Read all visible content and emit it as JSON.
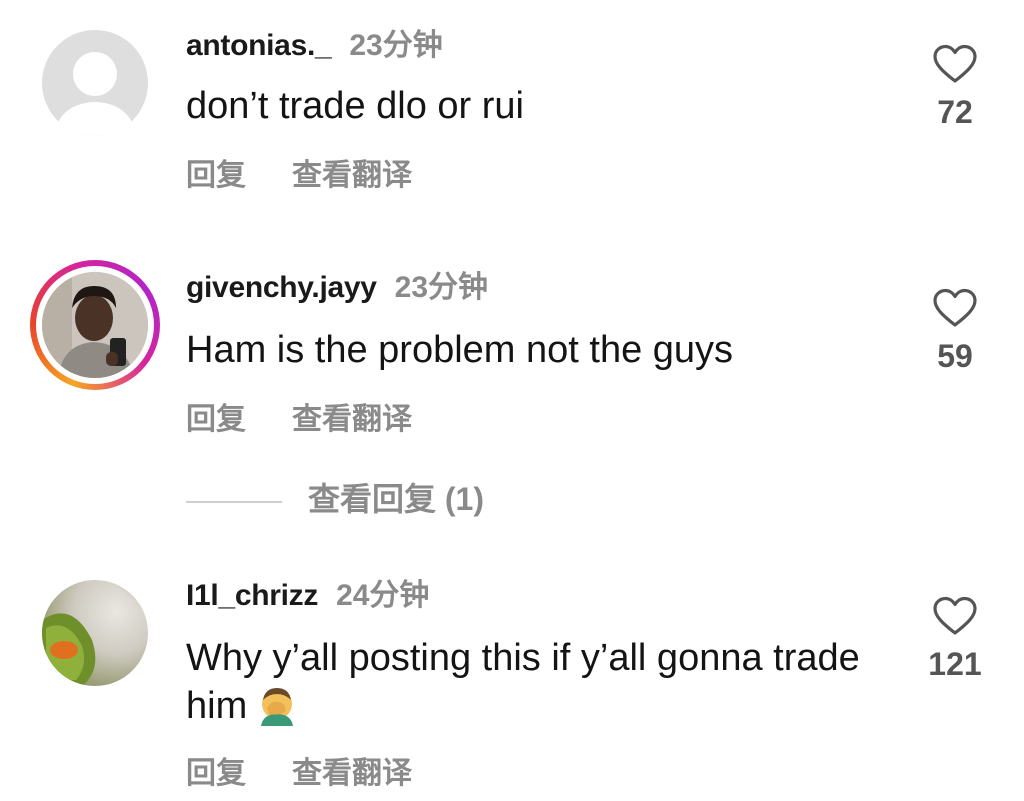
{
  "comments": [
    {
      "username": "antonias._",
      "time": "23分钟",
      "text": "don’t trade dlo or rui",
      "reply_label": "回复",
      "translate_label": "查看翻译",
      "likes": "72"
    },
    {
      "username": "givenchy.jayy",
      "time": "23分钟",
      "text": "Ham is the problem not the guys",
      "reply_label": "回复",
      "translate_label": "查看翻译",
      "likes": "59",
      "view_replies_label": "查看回复 (1)"
    },
    {
      "username": "I1l_chrizz",
      "time": "24分钟",
      "text": "Why y’all posting this if y’all gonna trade him",
      "reply_label": "回复",
      "translate_label": "查看翻译",
      "likes": "121"
    }
  ],
  "icons": {
    "like": "heart-icon",
    "emoji": "facepalm-emoji"
  }
}
